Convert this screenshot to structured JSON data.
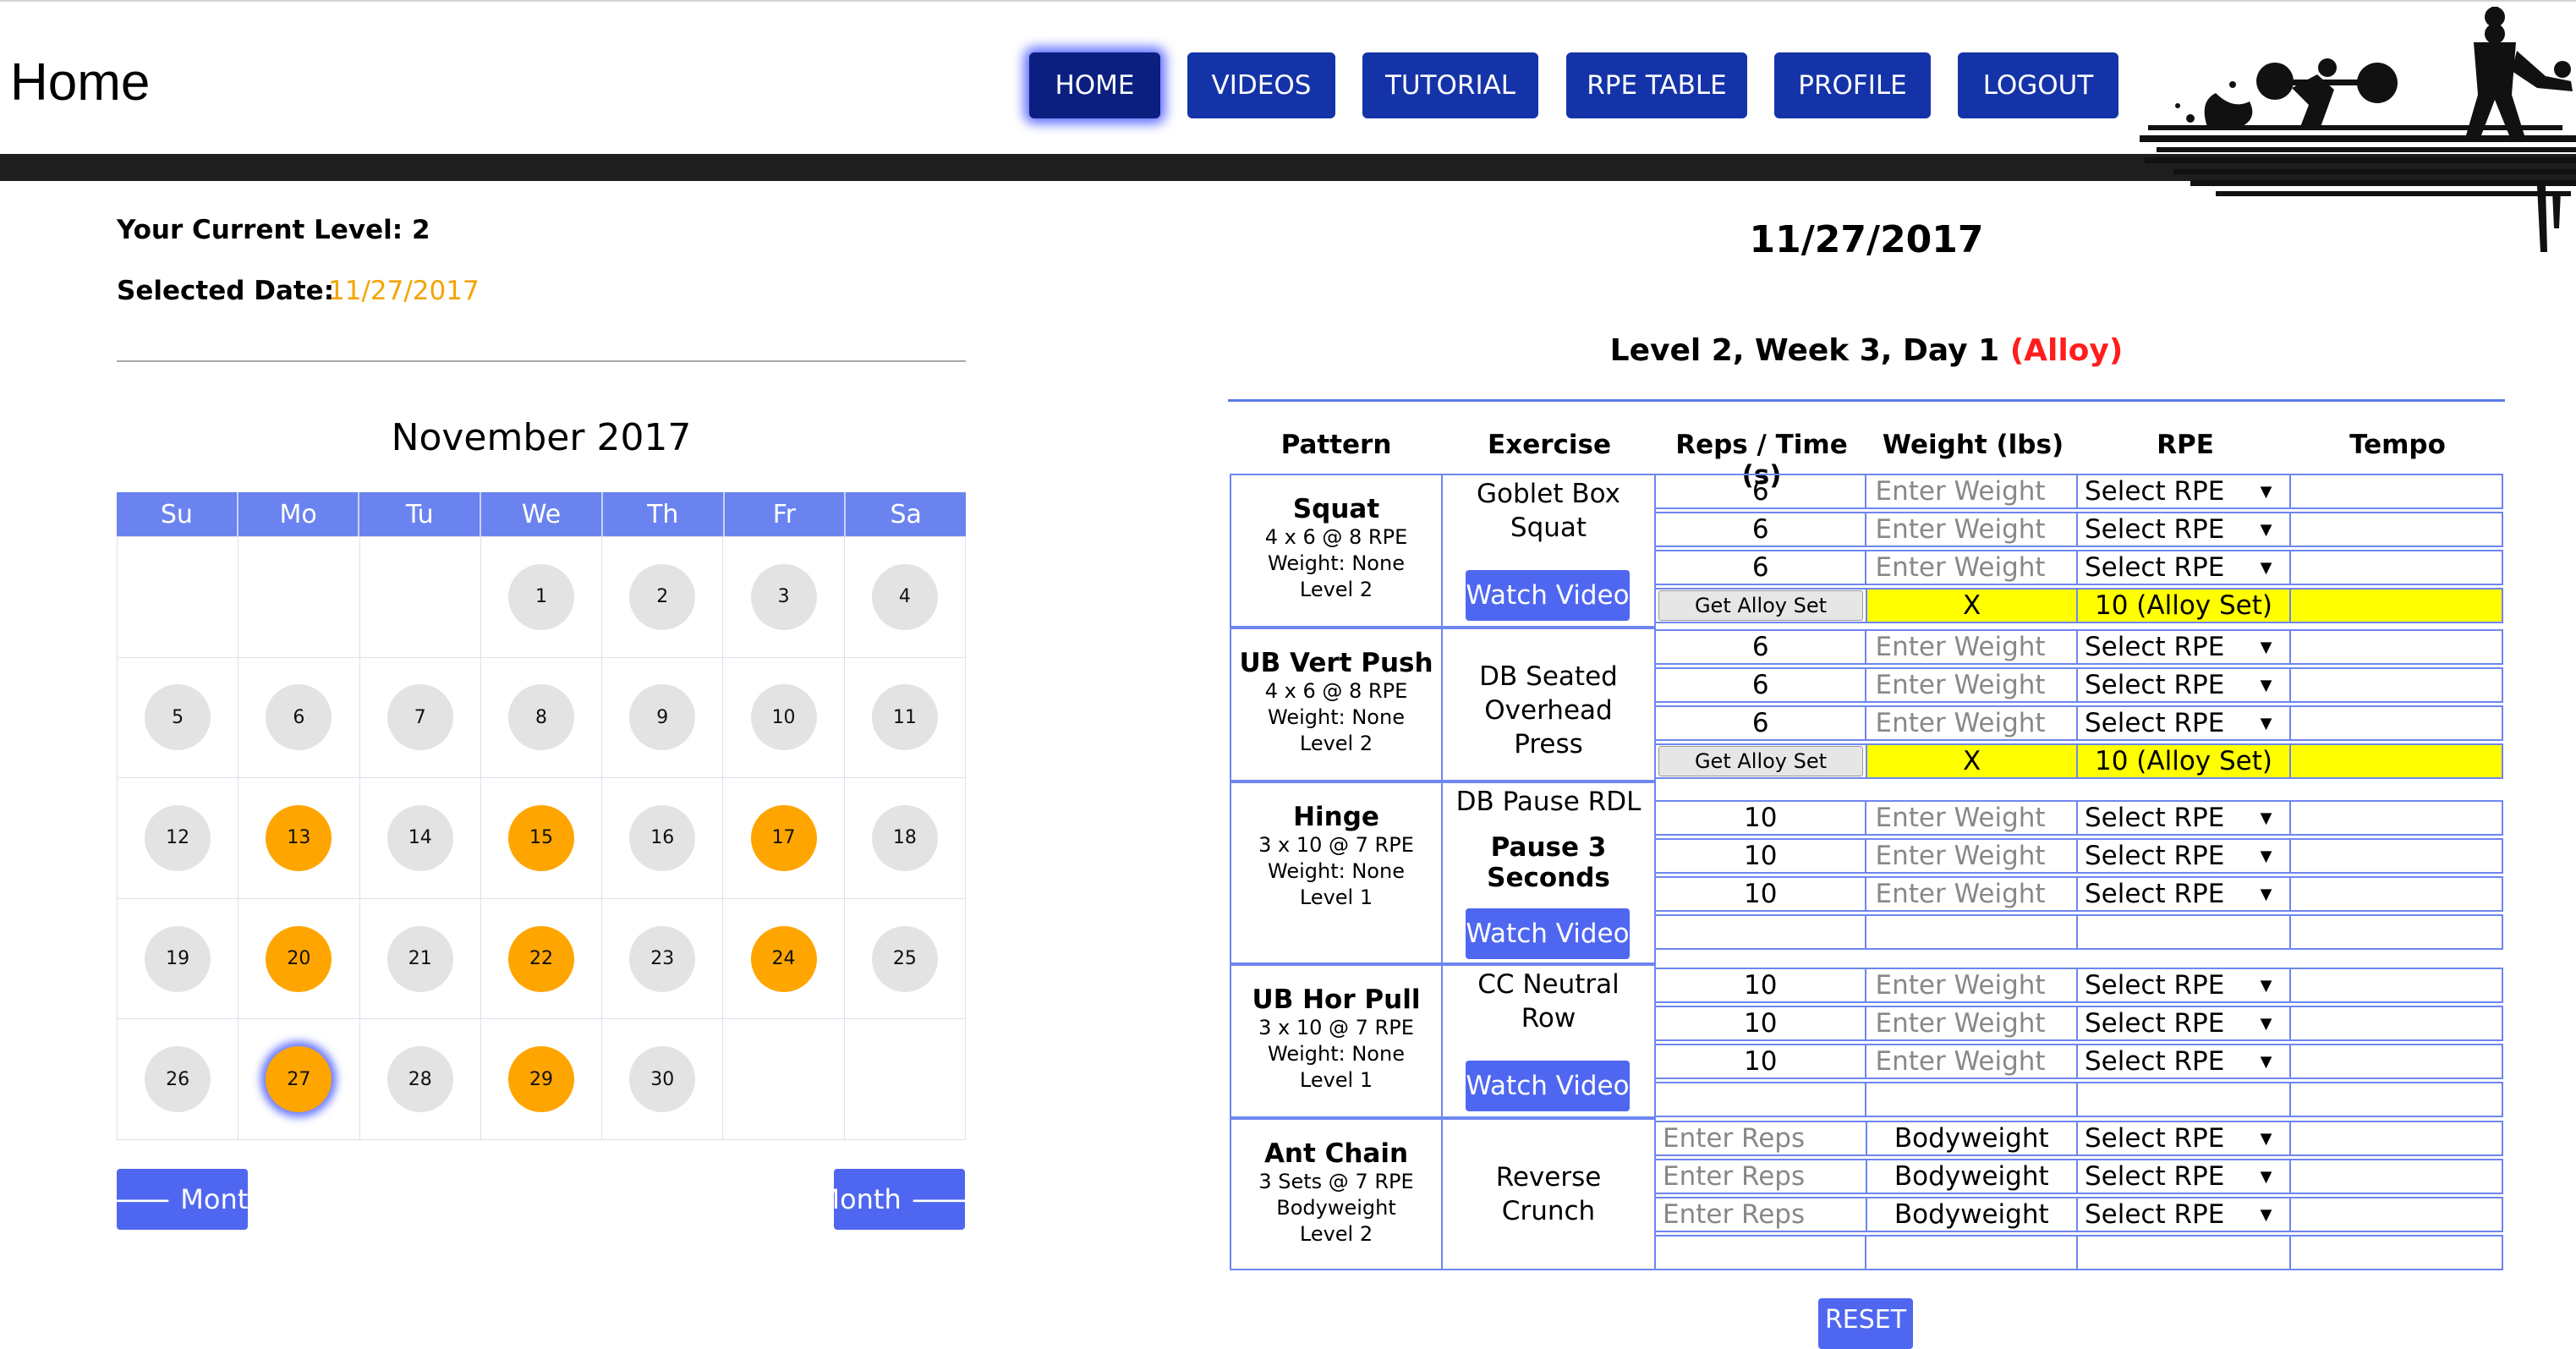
{
  "header": {
    "title": "Home",
    "nav": [
      "HOME",
      "VIDEOS",
      "TUTORIAL",
      "RPE TABLE",
      "PROFILE",
      "LOGOUT"
    ]
  },
  "info": {
    "level_label": "Your Current Level: 2",
    "date_label": "Selected Date:",
    "date_value": "11/27/2017"
  },
  "calendar": {
    "title": "November 2017",
    "weekdays": [
      "Su",
      "Mo",
      "Tu",
      "We",
      "Th",
      "Fr",
      "Sa"
    ],
    "days": [
      "",
      "",
      "",
      "1",
      "2",
      "3",
      "4",
      "5",
      "6",
      "7",
      "8",
      "9",
      "10",
      "11",
      "12",
      "13",
      "14",
      "15",
      "16",
      "17",
      "18",
      "19",
      "20",
      "21",
      "22",
      "23",
      "24",
      "25",
      "26",
      "27",
      "28",
      "29",
      "30",
      "",
      ""
    ],
    "workout_days": [
      "13",
      "15",
      "17",
      "20",
      "22",
      "24",
      "27",
      "29"
    ],
    "selected_day": "27",
    "prev_label": "Month",
    "next_label": "Month"
  },
  "workout": {
    "date": "11/27/2017",
    "title": "Level 2, Week 3, Day 1",
    "title_tag": "(Alloy)",
    "columns": [
      "Pattern",
      "Exercise",
      "Reps / Time (s)",
      "Weight (lbs)",
      "RPE",
      "Tempo"
    ],
    "watch_label": "Watch Video",
    "alloy_button": "Get Alloy Set",
    "weight_placeholder": "Enter Weight",
    "reps_placeholder": "Enter Reps",
    "rpe_placeholder": "Select RPE",
    "alloy_weight": "X",
    "alloy_rpe": "10 (Alloy Set)",
    "bodyweight": "Bodyweight",
    "blocks": [
      {
        "pattern": "Squat",
        "scheme": "4 x 6 @ 8 RPE",
        "weight": "Weight: None",
        "level": "Level 2",
        "exercise": "Goblet Box Squat",
        "reps": [
          "6",
          "6",
          "6"
        ]
      },
      {
        "pattern": "UB Vert Push",
        "scheme": "4 x 6 @ 8 RPE",
        "weight": "Weight: None",
        "level": "Level 2",
        "exercise": "DB Seated Overhead Press",
        "reps": [
          "6",
          "6",
          "6"
        ]
      },
      {
        "pattern": "Hinge",
        "scheme": "3 x 10 @ 7 RPE",
        "weight": "Weight: None",
        "level": "Level 1",
        "exercise": "DB Pause RDL",
        "note": "Pause 3 Seconds",
        "reps": [
          "10",
          "10",
          "10"
        ]
      },
      {
        "pattern": "UB Hor Pull",
        "scheme": "3 x 10 @ 7 RPE",
        "weight": "Weight: None",
        "level": "Level 1",
        "exercise": "CC Neutral Row",
        "reps": [
          "10",
          "10",
          "10"
        ]
      },
      {
        "pattern": "Ant Chain",
        "scheme": "3 Sets @ 7 RPE",
        "weight": "Bodyweight",
        "level": "Level 2",
        "exercise": "Reverse Crunch",
        "reps": [
          "",
          "",
          ""
        ]
      }
    ],
    "reset_label": "RESET"
  }
}
